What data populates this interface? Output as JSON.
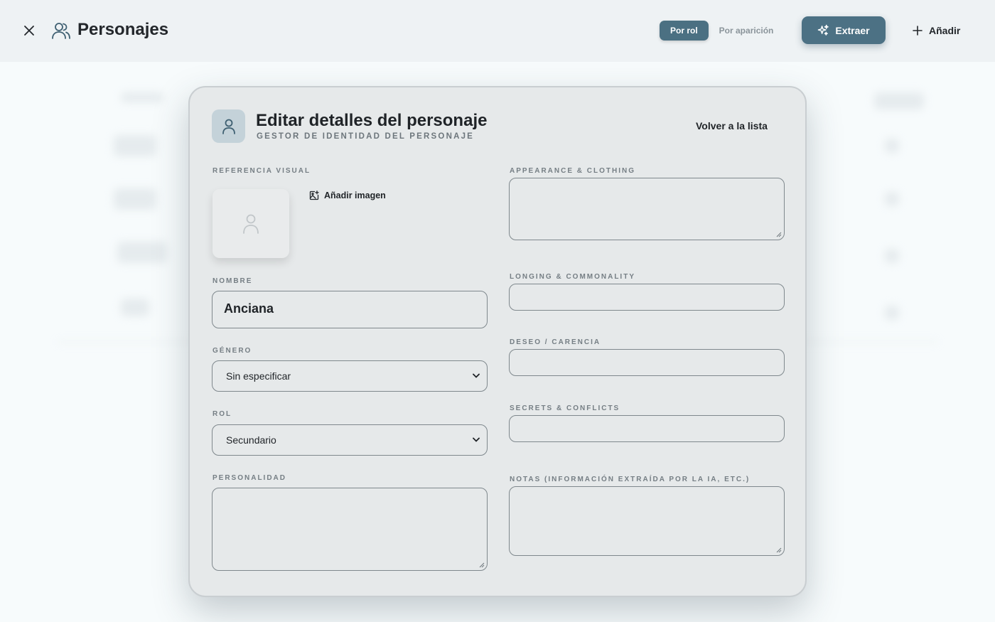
{
  "header": {
    "title": "Personajes",
    "segments": [
      {
        "label": "Por rol",
        "active": true
      },
      {
        "label": "Por aparición",
        "active": false
      }
    ],
    "extract_label": "Extraer",
    "add_label": "Añadir"
  },
  "modal": {
    "title": "Editar detalles del personaje",
    "subtitle": "GESTOR DE IDENTIDAD DEL PERSONAJE",
    "back_label": "Volver a la lista",
    "visual_ref_label": "REFERENCIA VISUAL",
    "add_image_label": "Añadir imagen",
    "name_label": "NOMBRE",
    "name_value": "Anciana",
    "gender_label": "GÉNERO",
    "gender_value": "Sin especificar",
    "role_label": "ROL",
    "role_value": "Secundario",
    "personality_label": "PERSONALIDAD",
    "appearance_label": "APPEARANCE & CLOTHING",
    "longing_label": "LONGING & COMMONALITY",
    "desire_label": "DESEO / CARENCIA",
    "secrets_label": "SECRETS & CONFLICTS",
    "notes_label": "NOTAS (INFORMACIÓN EXTRAÍDA POR LA IA, ETC.)"
  },
  "colors": {
    "accent": "#4c7184",
    "header_bg": "#eef2f4",
    "modal_bg": "#e6e9ea"
  },
  "icons": {
    "close": "close-icon",
    "people": "users-icon",
    "sparkle": "sparkle-icon",
    "plus": "plus-icon",
    "user": "user-icon",
    "image_add": "image-add-icon"
  }
}
